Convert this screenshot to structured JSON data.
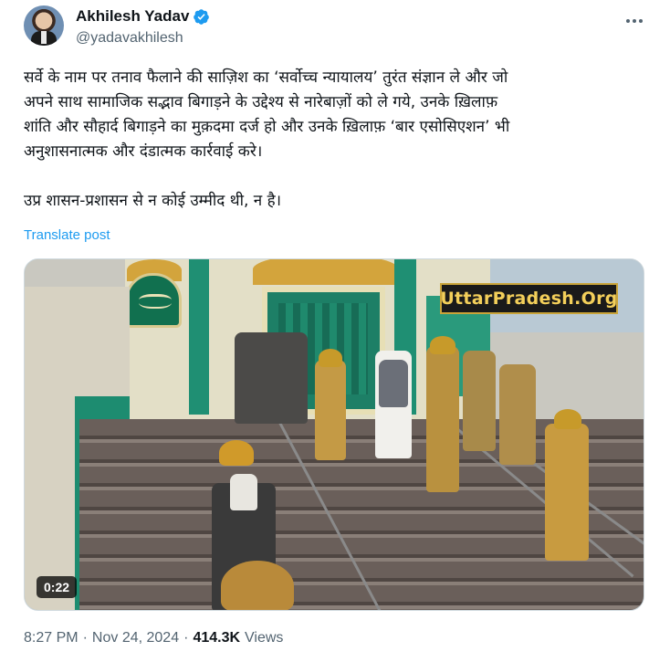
{
  "author": {
    "display_name": "Akhilesh Yadav",
    "handle": "@yadavakhilesh",
    "verified": true
  },
  "tweet": {
    "lines": [
      "सर्वे के नाम पर तनाव फैलाने की साज़िश का ‘सर्वोच्च न्यायालय’ तुरंत संज्ञान ले और जो",
      "अपने साथ सामाजिक सद्भाव बिगाड़ने के उद्देश्य से नारेबाज़ों को ले गये, उनके ख़िलाफ़",
      "शांति और सौहार्द बिगाड़ने का मुक़दमा दर्ज हो और उनके ख़िलाफ़ ‘बार एसोसिएशन’ भी",
      "अनुशासनात्मक और दंडात्मक कार्रवाई करे।",
      "उप्र शासन-प्रशासन से न कोई उम्मीद थी, न है।"
    ],
    "translate_label": "Translate post"
  },
  "media": {
    "watermark": "UttarPradesh.Org",
    "duration": "0:22"
  },
  "meta": {
    "time": "8:27 PM",
    "separator1": "·",
    "date": "Nov 24, 2024",
    "separator2": "·",
    "views_count": "414.3K",
    "views_label": "Views"
  },
  "colors": {
    "link": "#1d9bf0",
    "secondary_text": "#536471",
    "verified_badge": "#1d9bf0"
  },
  "icons": {
    "verified": "verified-badge-icon",
    "more": "more-options-icon",
    "play": "video-icon"
  }
}
